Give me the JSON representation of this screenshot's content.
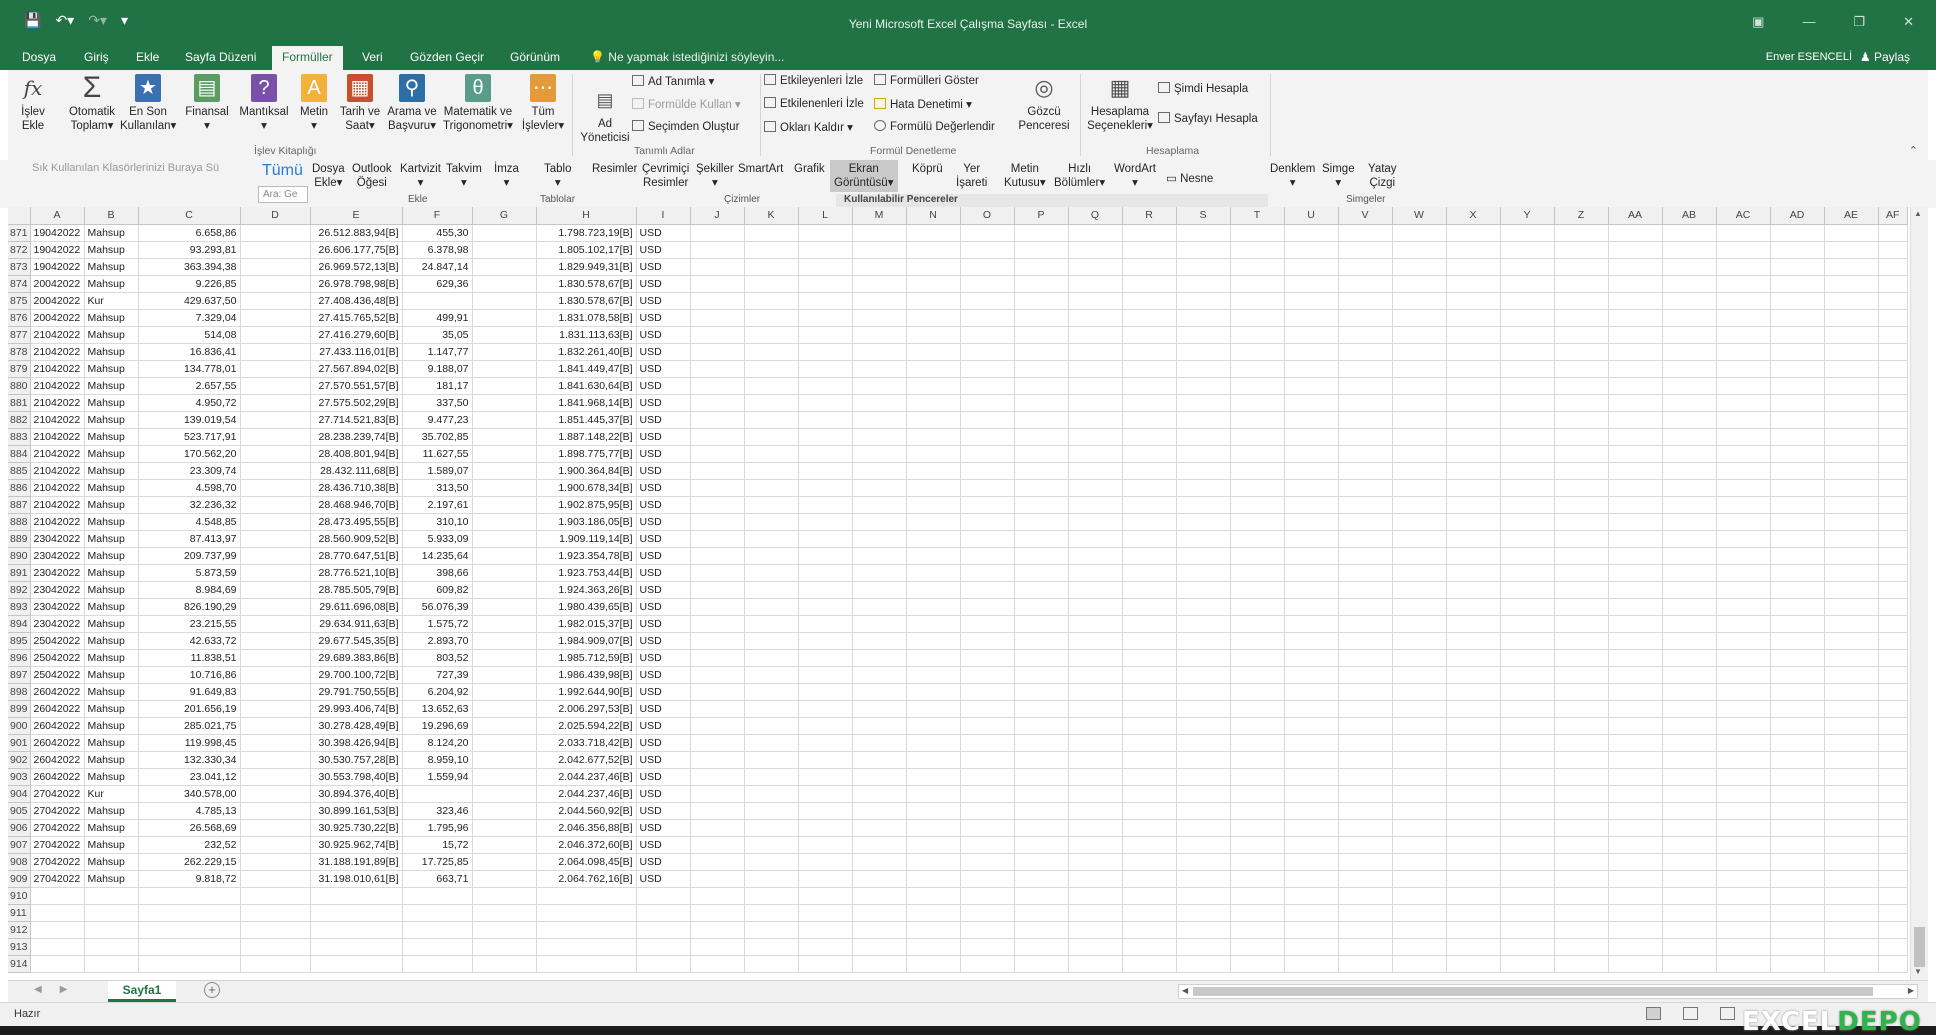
{
  "window": {
    "title": "Yeni Microsoft Excel Çalışma Sayfası - Excel",
    "user": "Enver ESENCELİ",
    "share": "Paylaş",
    "brand_color": "#217346"
  },
  "tabs": [
    "Dosya",
    "Giriş",
    "Ekle",
    "Sayfa Düzeni",
    "Formüller",
    "Veri",
    "Gözden Geçir",
    "Görünüm"
  ],
  "active_tab": "Formüller",
  "tell_me": "Ne yapmak istediğinizi söyleyin...",
  "ribbon": {
    "insert_function": [
      "İşlev",
      "Ekle"
    ],
    "library": [
      {
        "l1": "Otomatik",
        "l2": "Toplam",
        "icon": "sigma-icon"
      },
      {
        "l1": "En Son",
        "l2": "Kullanılan",
        "icon": "star-book-icon"
      },
      {
        "l1": "Finansal",
        "l2": "",
        "icon": "finance-book-icon"
      },
      {
        "l1": "Mantıksal",
        "l2": "",
        "icon": "logical-book-icon"
      },
      {
        "l1": "Metin",
        "l2": "",
        "icon": "text-book-icon"
      },
      {
        "l1": "Tarih ve",
        "l2": "Saat",
        "icon": "calendar-book-icon"
      },
      {
        "l1": "Arama ve",
        "l2": "Başvuru",
        "icon": "lookup-book-icon"
      },
      {
        "l1": "Matematik ve",
        "l2": "Trigonometri",
        "icon": "math-book-icon"
      },
      {
        "l1": "Tüm",
        "l2": "İşlevler",
        "icon": "more-functions-icon"
      }
    ],
    "library_group": "İşlev Kitaplığı",
    "name_manager": [
      "Ad",
      "Yöneticisi"
    ],
    "define_name": "Ad Tanımla",
    "use_in_formula": "Formülde Kullan",
    "create_from_selection": "Seçimden Oluştur",
    "names_group": "Tanımlı Adlar",
    "trace_precedents": "Etkileyenleri İzle",
    "trace_dependents": "Etkilenenleri İzle",
    "remove_arrows": "Okları Kaldır",
    "show_formulas": "Formülleri Göster",
    "error_checking": "Hata Denetimi",
    "evaluate_formula": "Formülü Değerlendir",
    "watch_window": [
      "Gözcü",
      "Penceresi"
    ],
    "auditing_group": "Formül Denetleme",
    "calc_options": [
      "Hesaplama",
      "Seçenekleri"
    ],
    "calc_now": "Şimdi Hesapla",
    "calc_sheet": "Sayfayı Hesapla",
    "calc_group": "Hesaplama"
  },
  "insert_panel": {
    "quick_access_hint": "Sık Kullanılan Klasörlerinizi Buraya Sü",
    "tumu": "Tümü",
    "search": "Ara: Ge",
    "items": [
      {
        "l1": "Dosya",
        "l2": "Ekle"
      },
      {
        "l1": "Outlook",
        "l2": "Öğesi"
      },
      {
        "l1": "Kartvizit",
        "l2": ""
      },
      {
        "l1": "Takvim",
        "l2": ""
      },
      {
        "l1": "İmza",
        "l2": ""
      },
      {
        "l1": "Tablo",
        "l2": ""
      },
      {
        "l1": "Resimler",
        "l2": ""
      },
      {
        "l1": "Çevrimiçi",
        "l2": "Resimler"
      },
      {
        "l1": "Şekiller",
        "l2": ""
      },
      {
        "l1": "SmartArt",
        "l2": ""
      },
      {
        "l1": "Grafik",
        "l2": ""
      },
      {
        "l1": "Ekran",
        "l2": "Görüntüsü"
      },
      {
        "l1": "Köprü",
        "l2": ""
      },
      {
        "l1": "Yer",
        "l2": "İşareti"
      },
      {
        "l1": "Metin",
        "l2": "Kutusu"
      },
      {
        "l1": "Hızlı",
        "l2": "Bölümler"
      },
      {
        "l1": "WordArt",
        "l2": ""
      },
      {
        "l1": "Nesne",
        "l2": ""
      },
      {
        "l1": "Denklem",
        "l2": ""
      },
      {
        "l1": "Simge",
        "l2": ""
      },
      {
        "l1": "Yatay",
        "l2": "Çizgi"
      }
    ],
    "groups": [
      "Ekle",
      "Tablolar",
      "Çizimler",
      "Simgeler"
    ],
    "panel_title": "Kullanılabilir Pencereler"
  },
  "columns": [
    "A",
    "B",
    "C",
    "D",
    "E",
    "F",
    "G",
    "H",
    "I",
    "J",
    "K",
    "L",
    "M",
    "N",
    "O",
    "P",
    "Q",
    "R",
    "S",
    "T",
    "U",
    "V",
    "W",
    "X",
    "Y",
    "Z",
    "AA",
    "AB",
    "AC",
    "AD",
    "AE",
    "AF"
  ],
  "rows": [
    {
      "r": "871",
      "a": "19042022",
      "b": "Mahsup",
      "c": "6.658,86",
      "e": "26.512.883,94[B]",
      "f": "455,30",
      "h": "1.798.723,19[B]",
      "i": "USD"
    },
    {
      "r": "872",
      "a": "19042022",
      "b": "Mahsup",
      "c": "93.293,81",
      "e": "26.606.177,75[B]",
      "f": "6.378,98",
      "h": "1.805.102,17[B]",
      "i": "USD"
    },
    {
      "r": "873",
      "a": "19042022",
      "b": "Mahsup",
      "c": "363.394,38",
      "e": "26.969.572,13[B]",
      "f": "24.847,14",
      "h": "1.829.949,31[B]",
      "i": "USD"
    },
    {
      "r": "874",
      "a": "20042022",
      "b": "Mahsup",
      "c": "9.226,85",
      "e": "26.978.798,98[B]",
      "f": "629,36",
      "h": "1.830.578,67[B]",
      "i": "USD"
    },
    {
      "r": "875",
      "a": "20042022",
      "b": "Kur",
      "c": "429.637,50",
      "e": "27.408.436,48[B]",
      "f": "",
      "h": "1.830.578,67[B]",
      "i": "USD"
    },
    {
      "r": "876",
      "a": "20042022",
      "b": "Mahsup",
      "c": "7.329,04",
      "e": "27.415.765,52[B]",
      "f": "499,91",
      "h": "1.831.078,58[B]",
      "i": "USD"
    },
    {
      "r": "877",
      "a": "21042022",
      "b": "Mahsup",
      "c": "514,08",
      "e": "27.416.279,60[B]",
      "f": "35,05",
      "h": "1.831.113,63[B]",
      "i": "USD"
    },
    {
      "r": "878",
      "a": "21042022",
      "b": "Mahsup",
      "c": "16.836,41",
      "e": "27.433.116,01[B]",
      "f": "1.147,77",
      "h": "1.832.261,40[B]",
      "i": "USD"
    },
    {
      "r": "879",
      "a": "21042022",
      "b": "Mahsup",
      "c": "134.778,01",
      "e": "27.567.894,02[B]",
      "f": "9.188,07",
      "h": "1.841.449,47[B]",
      "i": "USD"
    },
    {
      "r": "880",
      "a": "21042022",
      "b": "Mahsup",
      "c": "2.657,55",
      "e": "27.570.551,57[B]",
      "f": "181,17",
      "h": "1.841.630,64[B]",
      "i": "USD"
    },
    {
      "r": "881",
      "a": "21042022",
      "b": "Mahsup",
      "c": "4.950,72",
      "e": "27.575.502,29[B]",
      "f": "337,50",
      "h": "1.841.968,14[B]",
      "i": "USD"
    },
    {
      "r": "882",
      "a": "21042022",
      "b": "Mahsup",
      "c": "139.019,54",
      "e": "27.714.521,83[B]",
      "f": "9.477,23",
      "h": "1.851.445,37[B]",
      "i": "USD"
    },
    {
      "r": "883",
      "a": "21042022",
      "b": "Mahsup",
      "c": "523.717,91",
      "e": "28.238.239,74[B]",
      "f": "35.702,85",
      "h": "1.887.148,22[B]",
      "i": "USD"
    },
    {
      "r": "884",
      "a": "21042022",
      "b": "Mahsup",
      "c": "170.562,20",
      "e": "28.408.801,94[B]",
      "f": "11.627,55",
      "h": "1.898.775,77[B]",
      "i": "USD"
    },
    {
      "r": "885",
      "a": "21042022",
      "b": "Mahsup",
      "c": "23.309,74",
      "e": "28.432.111,68[B]",
      "f": "1.589,07",
      "h": "1.900.364,84[B]",
      "i": "USD"
    },
    {
      "r": "886",
      "a": "21042022",
      "b": "Mahsup",
      "c": "4.598,70",
      "e": "28.436.710,38[B]",
      "f": "313,50",
      "h": "1.900.678,34[B]",
      "i": "USD"
    },
    {
      "r": "887",
      "a": "21042022",
      "b": "Mahsup",
      "c": "32.236,32",
      "e": "28.468.946,70[B]",
      "f": "2.197,61",
      "h": "1.902.875,95[B]",
      "i": "USD"
    },
    {
      "r": "888",
      "a": "21042022",
      "b": "Mahsup",
      "c": "4.548,85",
      "e": "28.473.495,55[B]",
      "f": "310,10",
      "h": "1.903.186,05[B]",
      "i": "USD"
    },
    {
      "r": "889",
      "a": "23042022",
      "b": "Mahsup",
      "c": "87.413,97",
      "e": "28.560.909,52[B]",
      "f": "5.933,09",
      "h": "1.909.119,14[B]",
      "i": "USD"
    },
    {
      "r": "890",
      "a": "23042022",
      "b": "Mahsup",
      "c": "209.737,99",
      "e": "28.770.647,51[B]",
      "f": "14.235,64",
      "h": "1.923.354,78[B]",
      "i": "USD"
    },
    {
      "r": "891",
      "a": "23042022",
      "b": "Mahsup",
      "c": "5.873,59",
      "e": "28.776.521,10[B]",
      "f": "398,66",
      "h": "1.923.753,44[B]",
      "i": "USD"
    },
    {
      "r": "892",
      "a": "23042022",
      "b": "Mahsup",
      "c": "8.984,69",
      "e": "28.785.505,79[B]",
      "f": "609,82",
      "h": "1.924.363,26[B]",
      "i": "USD"
    },
    {
      "r": "893",
      "a": "23042022",
      "b": "Mahsup",
      "c": "826.190,29",
      "e": "29.611.696,08[B]",
      "f": "56.076,39",
      "h": "1.980.439,65[B]",
      "i": "USD"
    },
    {
      "r": "894",
      "a": "23042022",
      "b": "Mahsup",
      "c": "23.215,55",
      "e": "29.634.911,63[B]",
      "f": "1.575,72",
      "h": "1.982.015,37[B]",
      "i": "USD"
    },
    {
      "r": "895",
      "a": "25042022",
      "b": "Mahsup",
      "c": "42.633,72",
      "e": "29.677.545,35[B]",
      "f": "2.893,70",
      "h": "1.984.909,07[B]",
      "i": "USD"
    },
    {
      "r": "896",
      "a": "25042022",
      "b": "Mahsup",
      "c": "11.838,51",
      "e": "29.689.383,86[B]",
      "f": "803,52",
      "h": "1.985.712,59[B]",
      "i": "USD"
    },
    {
      "r": "897",
      "a": "25042022",
      "b": "Mahsup",
      "c": "10.716,86",
      "e": "29.700.100,72[B]",
      "f": "727,39",
      "h": "1.986.439,98[B]",
      "i": "USD"
    },
    {
      "r": "898",
      "a": "26042022",
      "b": "Mahsup",
      "c": "91.649,83",
      "e": "29.791.750,55[B]",
      "f": "6.204,92",
      "h": "1.992.644,90[B]",
      "i": "USD"
    },
    {
      "r": "899",
      "a": "26042022",
      "b": "Mahsup",
      "c": "201.656,19",
      "e": "29.993.406,74[B]",
      "f": "13.652,63",
      "h": "2.006.297,53[B]",
      "i": "USD"
    },
    {
      "r": "900",
      "a": "26042022",
      "b": "Mahsup",
      "c": "285.021,75",
      "e": "30.278.428,49[B]",
      "f": "19.296,69",
      "h": "2.025.594,22[B]",
      "i": "USD"
    },
    {
      "r": "901",
      "a": "26042022",
      "b": "Mahsup",
      "c": "119.998,45",
      "e": "30.398.426,94[B]",
      "f": "8.124,20",
      "h": "2.033.718,42[B]",
      "i": "USD"
    },
    {
      "r": "902",
      "a": "26042022",
      "b": "Mahsup",
      "c": "132.330,34",
      "e": "30.530.757,28[B]",
      "f": "8.959,10",
      "h": "2.042.677,52[B]",
      "i": "USD"
    },
    {
      "r": "903",
      "a": "26042022",
      "b": "Mahsup",
      "c": "23.041,12",
      "e": "30.553.798,40[B]",
      "f": "1.559,94",
      "h": "2.044.237,46[B]",
      "i": "USD"
    },
    {
      "r": "904",
      "a": "27042022",
      "b": "Kur",
      "c": "340.578,00",
      "e": "30.894.376,40[B]",
      "f": "",
      "h": "2.044.237,46[B]",
      "i": "USD"
    },
    {
      "r": "905",
      "a": "27042022",
      "b": "Mahsup",
      "c": "4.785,13",
      "e": "30.899.161,53[B]",
      "f": "323,46",
      "h": "2.044.560,92[B]",
      "i": "USD"
    },
    {
      "r": "906",
      "a": "27042022",
      "b": "Mahsup",
      "c": "26.568,69",
      "e": "30.925.730,22[B]",
      "f": "1.795,96",
      "h": "2.046.356,88[B]",
      "i": "USD"
    },
    {
      "r": "907",
      "a": "27042022",
      "b": "Mahsup",
      "c": "232,52",
      "e": "30.925.962,74[B]",
      "f": "15,72",
      "h": "2.046.372,60[B]",
      "i": "USD"
    },
    {
      "r": "908",
      "a": "27042022",
      "b": "Mahsup",
      "c": "262.229,15",
      "e": "31.188.191,89[B]",
      "f": "17.725,85",
      "h": "2.064.098,45[B]",
      "i": "USD"
    },
    {
      "r": "909",
      "a": "27042022",
      "b": "Mahsup",
      "c": "9.818,72",
      "e": "31.198.010,61[B]",
      "f": "663,71",
      "h": "2.064.762,16[B]",
      "i": "USD"
    },
    {
      "r": "910"
    },
    {
      "r": "911"
    },
    {
      "r": "912"
    },
    {
      "r": "913"
    },
    {
      "r": "914"
    }
  ],
  "sheet_tab": "Sayfa1",
  "status": "Hazır",
  "watermark": "EXCEL DEPO"
}
